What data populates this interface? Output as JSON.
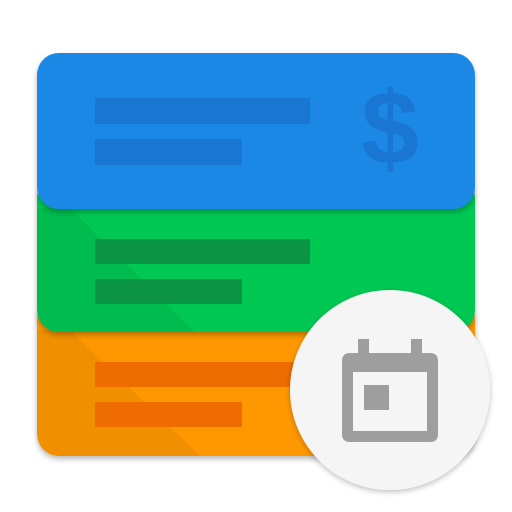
{
  "app_icon": {
    "description_icon": "budget-calendar-app-icon",
    "cards": [
      {
        "name": "blue-card",
        "color": "#1E88E5",
        "line_color": "#1976D2"
      },
      {
        "name": "green-card",
        "color": "#00C853",
        "line_color": "#0B9444"
      },
      {
        "name": "orange-card",
        "color": "#FF9800",
        "line_color": "#EF6C00"
      }
    ],
    "currency_symbol": "$",
    "badge": {
      "icon": "calendar-icon",
      "background": "#F5F5F5",
      "icon_color": "#9E9E9E"
    }
  }
}
